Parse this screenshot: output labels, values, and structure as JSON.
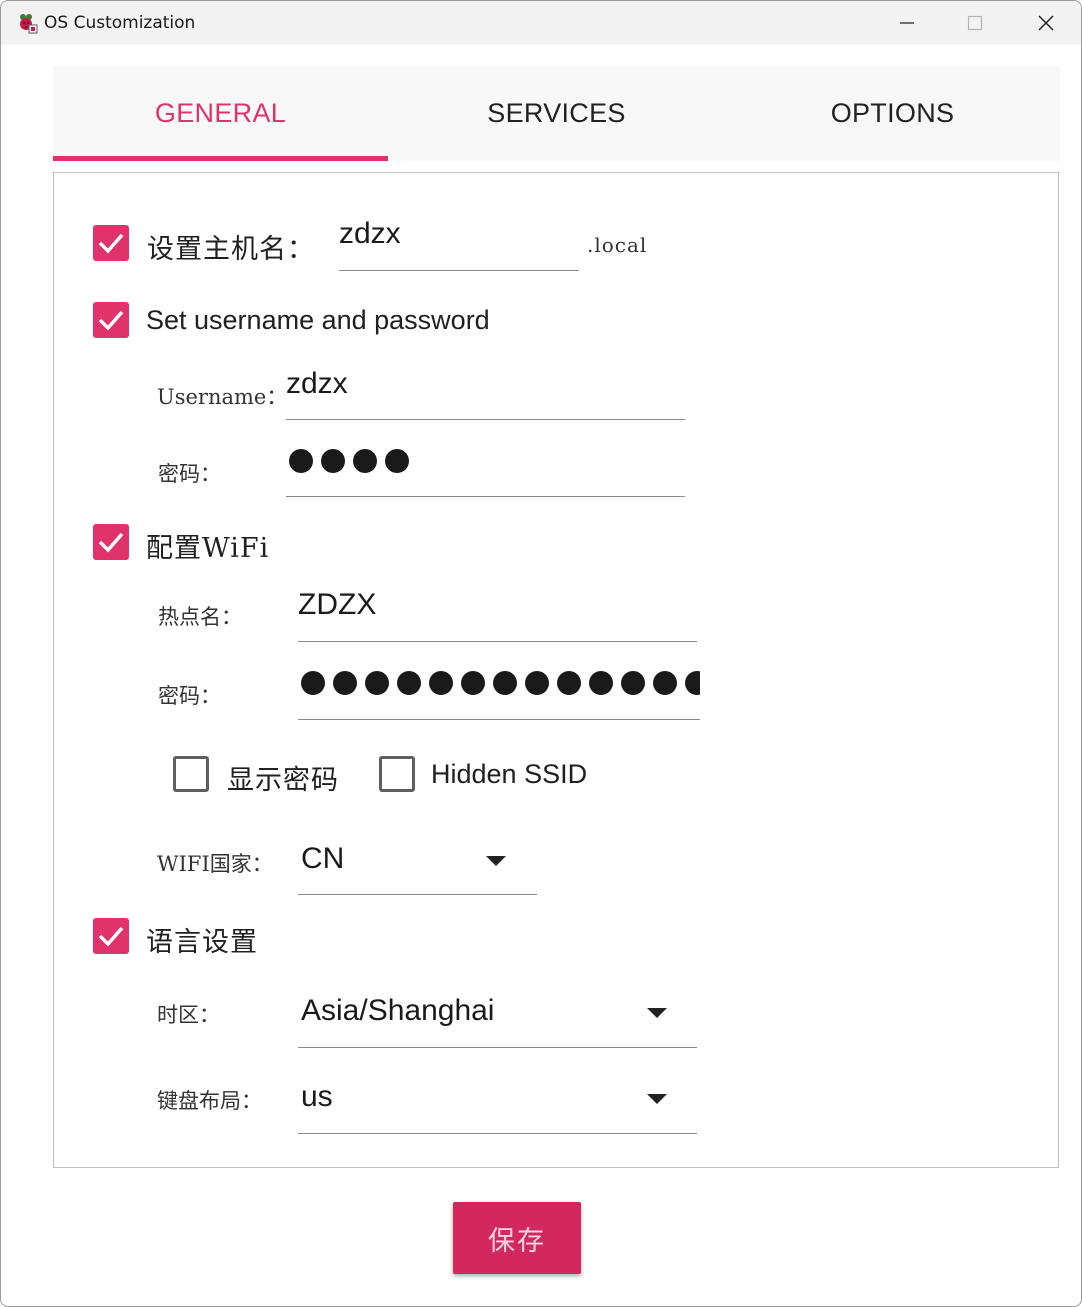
{
  "window": {
    "title": "OS Customization"
  },
  "tabs": [
    {
      "label": "GENERAL",
      "active": true
    },
    {
      "label": "SERVICES",
      "active": false
    },
    {
      "label": "OPTIONS",
      "active": false
    }
  ],
  "general": {
    "hostname": {
      "checked": true,
      "label": "设置主机名：",
      "value": "zdzx",
      "suffix": ".local"
    },
    "user": {
      "checked": true,
      "label": "Set username and password",
      "username_label": "Username：",
      "username_value": "zdzx",
      "password_label": "密码：",
      "password_length": 4
    },
    "wifi": {
      "checked": true,
      "label": "配置WiFi",
      "ssid_label": "热点名：",
      "ssid_value": "ZDZX",
      "password_label": "密码：",
      "password_length": 14,
      "show_password": {
        "checked": false,
        "label": "显示密码"
      },
      "hidden_ssid": {
        "checked": false,
        "label": "Hidden SSID"
      },
      "country_label": "WIFI国家：",
      "country_value": "CN"
    },
    "locale": {
      "checked": true,
      "label": "语言设置",
      "timezone_label": "时区：",
      "timezone_value": "Asia/Shanghai",
      "keyboard_label": "键盘布局：",
      "keyboard_value": "us"
    }
  },
  "save_label": "保存",
  "colors": {
    "accent": "#e0336b",
    "button": "#d3285f"
  }
}
